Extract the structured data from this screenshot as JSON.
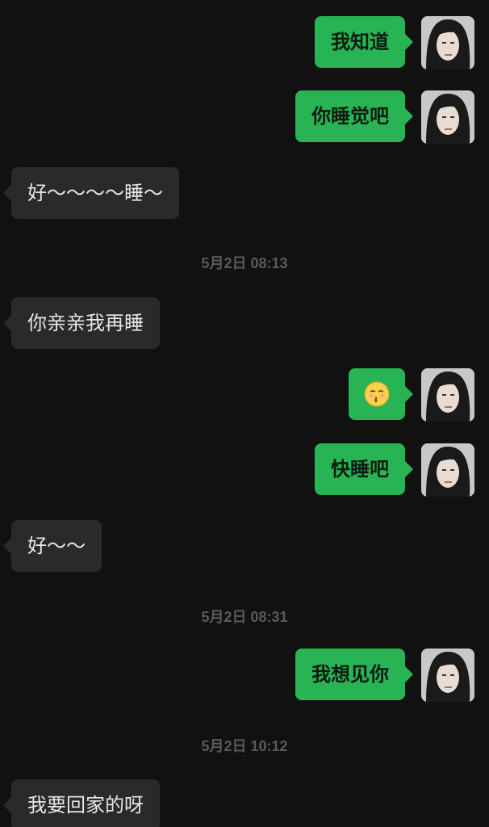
{
  "messages": [
    {
      "side": "right",
      "text": "我知道"
    },
    {
      "side": "right",
      "text": "你睡觉吧"
    },
    {
      "side": "left",
      "text": "好～～～～睡～"
    },
    {
      "timestamp": "5月2日 08:13"
    },
    {
      "side": "left",
      "text": "你亲亲我再睡"
    },
    {
      "side": "right",
      "emoji": "kissing-face-with-closed-eyes"
    },
    {
      "side": "right",
      "text": "快睡吧"
    },
    {
      "side": "left",
      "text": "好～～"
    },
    {
      "timestamp": "5月2日 08:31"
    },
    {
      "side": "right",
      "text": "我想见你"
    },
    {
      "timestamp": "5月2日 10:12"
    },
    {
      "side": "left",
      "text": "我要回家的呀"
    }
  ],
  "colors": {
    "background": "#111111",
    "sent_bubble": "#28b454",
    "received_bubble": "#2a2a2a",
    "timestamp": "#5a5a5a"
  }
}
